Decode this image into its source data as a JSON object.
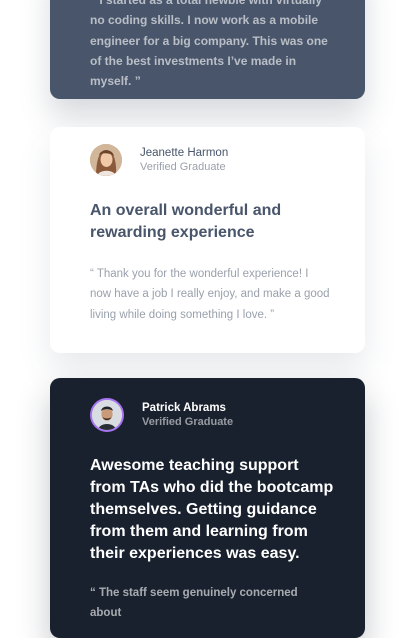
{
  "colors": {
    "slate_card": "#48556a",
    "dark_card": "#19212e",
    "white_card": "#ffffff",
    "accent_purple": "#a775f1",
    "muted_text": "#9aa1ac"
  },
  "testimonials": [
    {
      "theme": "slate",
      "quote": "“ I started as a total newbie with virtually no coding skills. I now work as a mobile engineer for a big company. This was one of the best investments I’ve made in myself. ”"
    },
    {
      "theme": "white",
      "name": "Jeanette Harmon",
      "role": "Verified Graduate",
      "avatar_icon": "user-avatar-photo-icon",
      "headline": "An overall wonderful and rewarding experience",
      "quote": "“ Thank you for the wonderful experience! I now have a job I really enjoy, and make a good living while doing something I love. ”"
    },
    {
      "theme": "dark",
      "name": "Patrick Abrams",
      "role": "Verified Graduate",
      "avatar_icon": "user-avatar-photo-icon",
      "headline": "Awesome teaching support from TAs who did the bootcamp themselves. Getting guidance from them and learning from their experiences was easy.",
      "quote": "“ The staff seem genuinely concerned about"
    }
  ]
}
